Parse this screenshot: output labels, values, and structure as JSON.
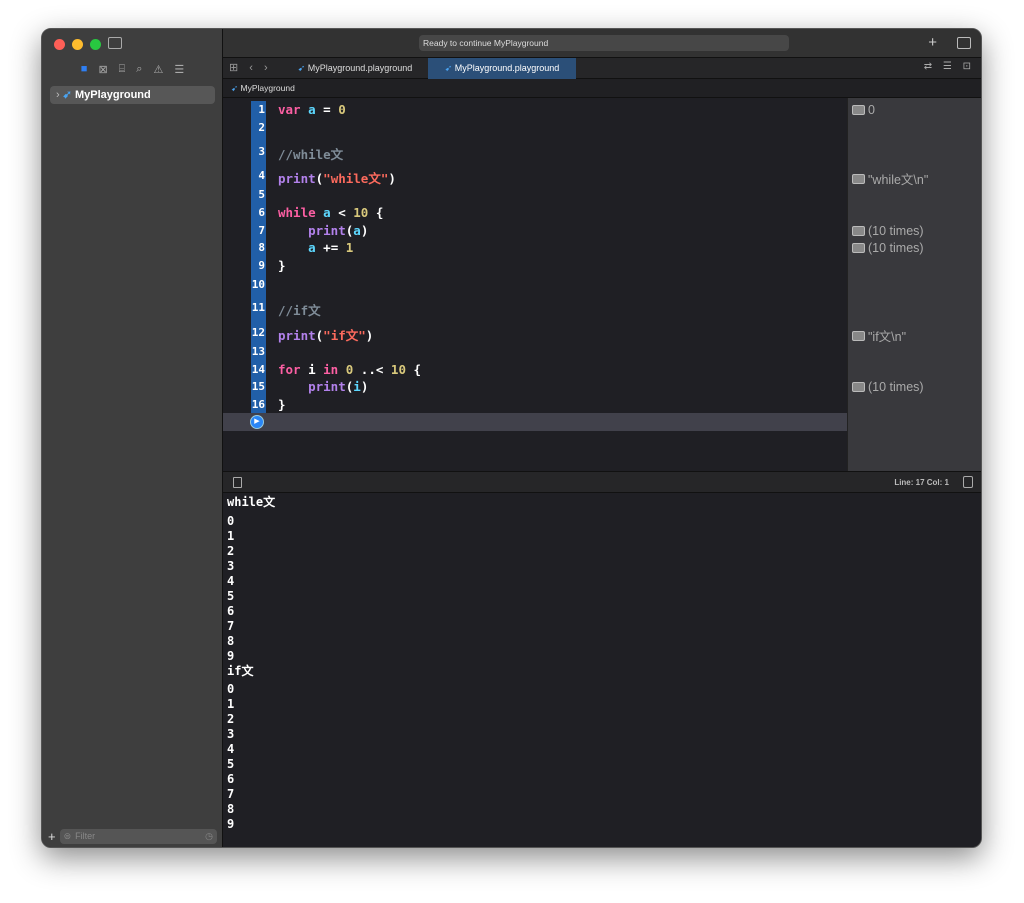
{
  "window": {
    "status": "Ready to continue MyPlayground"
  },
  "sidebar": {
    "item": "MyPlayground",
    "filter_placeholder": "Filter",
    "nav_icons": [
      "folder-icon",
      "source-control-icon",
      "hierarchy-icon",
      "search-icon",
      "warning-icon",
      "report-icon"
    ]
  },
  "tabs": [
    {
      "label": "MyPlayground.playground",
      "active": false
    },
    {
      "label": "MyPlayground.playground",
      "active": true
    }
  ],
  "breadcrumb": "MyPlayground",
  "colors": {
    "keyword": "#fc5fa3",
    "variable": "#5dd8ff",
    "function": "#b281eb",
    "string": "#fc6a5d",
    "number": "#d9c97c",
    "comment": "#7f8c98",
    "plain": "#ffffff",
    "accent": "#215fa8"
  },
  "code": [
    {
      "n": "1",
      "tokens": [
        [
          "keyword",
          "var"
        ],
        [
          "plain",
          " "
        ],
        [
          "variable",
          "a"
        ],
        [
          "plain",
          " = "
        ],
        [
          "number",
          "0"
        ]
      ]
    },
    {
      "n": "2",
      "tokens": []
    },
    {
      "n": "3",
      "tokens": [
        [
          "comment",
          "//while文"
        ]
      ]
    },
    {
      "n": "4",
      "tokens": [
        [
          "function",
          "print"
        ],
        [
          "plain",
          "("
        ],
        [
          "string",
          "\"while文\""
        ],
        [
          "plain",
          ")"
        ]
      ]
    },
    {
      "n": "5",
      "tokens": []
    },
    {
      "n": "6",
      "tokens": [
        [
          "keyword",
          "while"
        ],
        [
          "plain",
          " "
        ],
        [
          "variable",
          "a"
        ],
        [
          "plain",
          " < "
        ],
        [
          "number",
          "10"
        ],
        [
          "plain",
          " {"
        ]
      ]
    },
    {
      "n": "7",
      "tokens": [
        [
          "plain",
          "    "
        ],
        [
          "function",
          "print"
        ],
        [
          "plain",
          "("
        ],
        [
          "variable",
          "a"
        ],
        [
          "plain",
          ")"
        ]
      ]
    },
    {
      "n": "8",
      "tokens": [
        [
          "plain",
          "    "
        ],
        [
          "variable",
          "a"
        ],
        [
          "plain",
          " += "
        ],
        [
          "number",
          "1"
        ]
      ]
    },
    {
      "n": "9",
      "tokens": [
        [
          "plain",
          "}"
        ]
      ]
    },
    {
      "n": "10",
      "tokens": []
    },
    {
      "n": "11",
      "tokens": [
        [
          "comment",
          "//if文"
        ]
      ]
    },
    {
      "n": "12",
      "tokens": [
        [
          "function",
          "print"
        ],
        [
          "plain",
          "("
        ],
        [
          "string",
          "\"if文\""
        ],
        [
          "plain",
          ")"
        ]
      ]
    },
    {
      "n": "13",
      "tokens": []
    },
    {
      "n": "14",
      "tokens": [
        [
          "keyword",
          "for"
        ],
        [
          "plain",
          " i "
        ],
        [
          "keyword",
          "in"
        ],
        [
          "plain",
          " "
        ],
        [
          "number",
          "0"
        ],
        [
          "plain",
          " ..< "
        ],
        [
          "number",
          "10"
        ],
        [
          "plain",
          " {"
        ]
      ]
    },
    {
      "n": "15",
      "tokens": [
        [
          "plain",
          "    "
        ],
        [
          "function",
          "print"
        ],
        [
          "plain",
          "("
        ],
        [
          "variable",
          "i"
        ],
        [
          "plain",
          ")"
        ]
      ]
    },
    {
      "n": "16",
      "tokens": [
        [
          "plain",
          "}"
        ]
      ]
    }
  ],
  "results": [
    {
      "line": "1",
      "text": "0"
    },
    {
      "line": "4",
      "text": "\"while文\\n\""
    },
    {
      "line": "7",
      "text": "(10 times)"
    },
    {
      "line": "8",
      "text": "(10 times)"
    },
    {
      "line": "12",
      "text": "\"if文\\n\""
    },
    {
      "line": "15",
      "text": "(10 times)"
    }
  ],
  "debug": {
    "position": "Line: 17  Col: 1"
  },
  "console": [
    "while文",
    "0",
    "1",
    "2",
    "3",
    "4",
    "5",
    "6",
    "7",
    "8",
    "9",
    "if文",
    "0",
    "1",
    "2",
    "3",
    "4",
    "5",
    "6",
    "7",
    "8",
    "9"
  ]
}
